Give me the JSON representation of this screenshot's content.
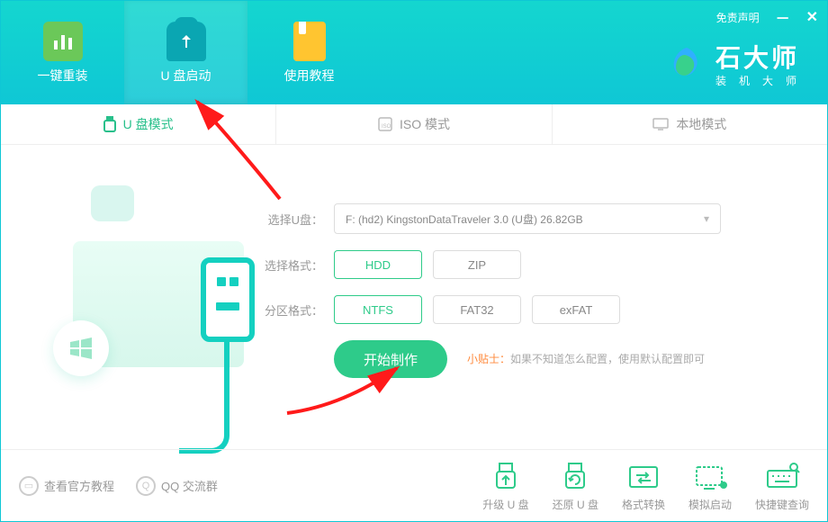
{
  "header": {
    "tabs": [
      {
        "label": "一键重装"
      },
      {
        "label": "U 盘启动"
      },
      {
        "label": "使用教程"
      }
    ],
    "disclaimer": "免责声明",
    "logo_main": "石大师",
    "logo_sub": "装机大师"
  },
  "modes": [
    {
      "label": "U 盘模式",
      "active": true
    },
    {
      "label": "ISO 模式",
      "active": false
    },
    {
      "label": "本地模式",
      "active": false
    }
  ],
  "form": {
    "select_udisk_label": "选择U盘：",
    "select_udisk_value": "F: (hd2) KingstonDataTraveler 3.0 (U盘) 26.82GB",
    "select_format_label": "选择格式：",
    "format_options": [
      "HDD",
      "ZIP"
    ],
    "format_selected": "HDD",
    "partition_label": "分区格式：",
    "partition_options": [
      "NTFS",
      "FAT32",
      "exFAT"
    ],
    "partition_selected": "NTFS",
    "start_button": "开始制作",
    "tip_label": "小贴士：",
    "tip_text": "如果不知道怎么配置，使用默认配置即可"
  },
  "footer": {
    "links": [
      {
        "label": "查看官方教程"
      },
      {
        "label": "QQ 交流群"
      }
    ],
    "actions": [
      {
        "label": "升级 U 盘"
      },
      {
        "label": "还原 U 盘"
      },
      {
        "label": "格式转换"
      },
      {
        "label": "模拟启动"
      },
      {
        "label": "快捷键查询"
      }
    ]
  }
}
